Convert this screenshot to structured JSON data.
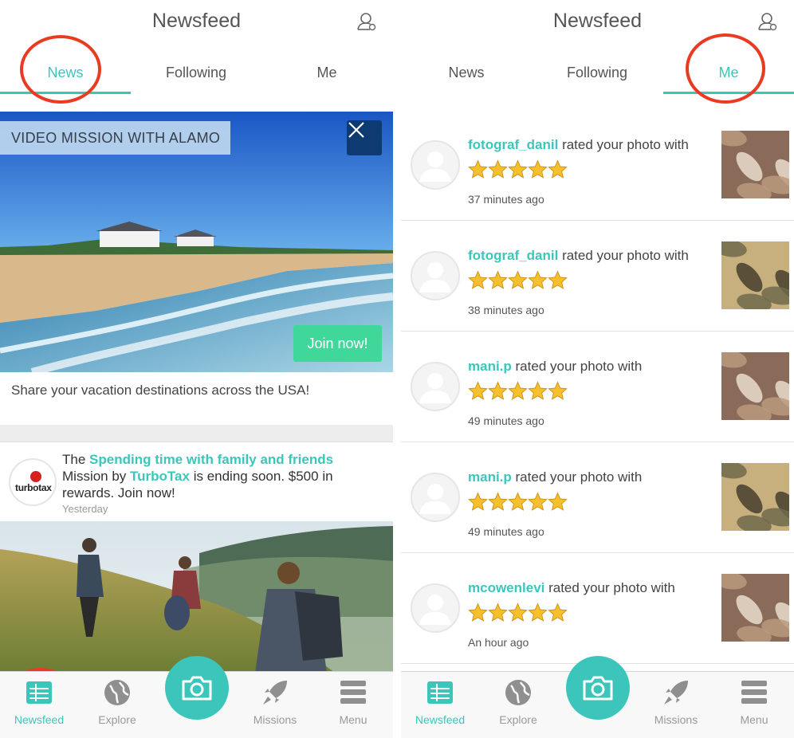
{
  "app": {
    "title": "Newsfeed"
  },
  "tabs": [
    {
      "label": "News"
    },
    {
      "label": "Following"
    },
    {
      "label": "Me"
    }
  ],
  "left_feed": {
    "hero": {
      "tag": "VIDEO MISSION WITH ALAMO",
      "join_label": "Join now!",
      "caption": "Share your vacation destinations across the USA!"
    },
    "mission_card": {
      "logo_text": "turbotax",
      "text_before": "The ",
      "mission_name": "Spending time with family and friends",
      "text_middle": " Mission by ",
      "brand": "TurboTax",
      "text_after": " is ending soon. $500 in rewards. Join now!",
      "time": "Yesterday"
    }
  },
  "notifications": [
    {
      "user": "fotograf_danil",
      "action": " rated your photo with",
      "stars": 5,
      "time": "37 minutes ago"
    },
    {
      "user": "fotograf_danil",
      "action": " rated your photo with",
      "stars": 5,
      "time": "38 minutes ago"
    },
    {
      "user": "mani.p",
      "action": " rated your photo with",
      "stars": 5,
      "time": "49 minutes ago"
    },
    {
      "user": "mani.p",
      "action": " rated your photo with",
      "stars": 5,
      "time": "49 minutes ago"
    },
    {
      "user": "mcowenlevi",
      "action": " rated your photo with",
      "stars": 5,
      "time": "An hour ago"
    }
  ],
  "nav": {
    "items": [
      {
        "label": "Newsfeed",
        "icon": "newsfeed-icon"
      },
      {
        "label": "Explore",
        "icon": "globe-icon"
      },
      {
        "label": "Missions",
        "icon": "rocket-icon"
      },
      {
        "label": "Menu",
        "icon": "menu-icon"
      }
    ],
    "camera_icon": "camera-icon"
  },
  "colors": {
    "accent": "#3cc6bb",
    "join": "#40d79a",
    "annotation": "#e83b21",
    "star": "#f6c02c"
  }
}
